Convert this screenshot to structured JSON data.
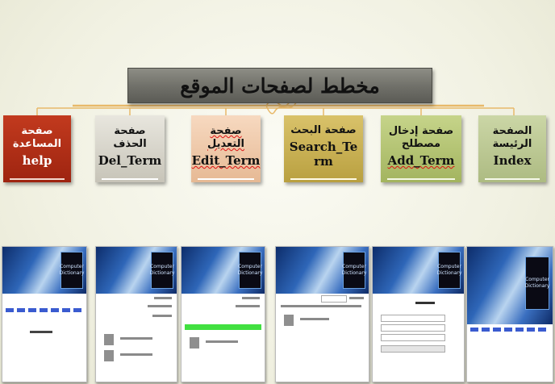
{
  "diagram": {
    "title": "مخطط لصفحات الموقع",
    "nodes": [
      {
        "key": "help",
        "arabic": "صفحة المساعدة",
        "english": "help"
      },
      {
        "key": "del",
        "arabic": "صفحة الحذف",
        "english": "Del_Term"
      },
      {
        "key": "edit",
        "arabic": "صفحة التعديل",
        "english": "Edit_Term"
      },
      {
        "key": "search",
        "arabic": "صفحة البحث",
        "english": "Search_Term"
      },
      {
        "key": "add",
        "arabic": "صفحة إدخال مصطلح",
        "english": "Add_Term"
      },
      {
        "key": "index",
        "arabic": "الصفحة الرئيسة",
        "english": "Index"
      }
    ]
  },
  "screenshots": [
    {
      "name": "help-page-screenshot",
      "logo": "Computer Dictionary"
    },
    {
      "name": "del-page-screenshot",
      "logo": "Computer Dictionary"
    },
    {
      "name": "edit-page-screenshot",
      "logo": "Computer Dictionary"
    },
    {
      "name": "search-page-screenshot",
      "logo": "Computer Dictionary"
    },
    {
      "name": "add-page-screenshot",
      "logo": "Computer Dictionary"
    },
    {
      "name": "index-page-screenshot",
      "logo": "Computer Dictionary"
    }
  ],
  "colors": {
    "help": "#b02e16",
    "del": "#d8d6cc",
    "edit": "#f0caa8",
    "search": "#c8b054",
    "add": "#b4c474",
    "index": "#bcc894",
    "title_bg": "#7a7a72",
    "connector": "#e8b96a"
  }
}
